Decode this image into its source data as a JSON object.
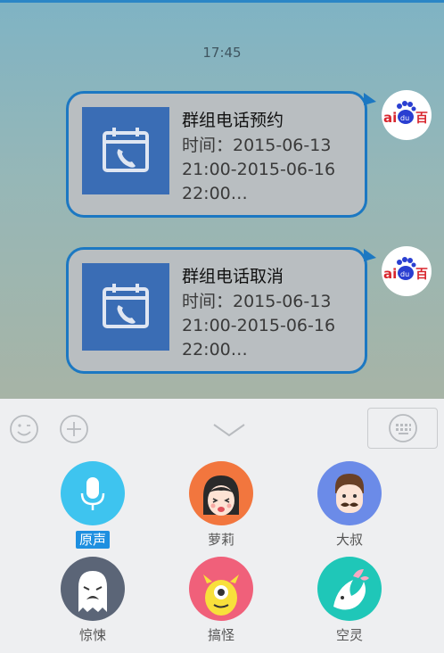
{
  "chat": {
    "time": "17:45",
    "messages": [
      {
        "title": "群组电话预约",
        "line1": "时间：2015-06-13",
        "line2": "21:00-2015-06-16",
        "line3": "22:00…",
        "avatar_text": "百度"
      },
      {
        "title": "群组电话取消",
        "line1": "时间：2015-06-13",
        "line2": "21:00-2015-06-16",
        "line3": "22:00…",
        "avatar_text": "百度"
      }
    ]
  },
  "panel": {
    "voices": [
      {
        "label": "原声",
        "selected": true,
        "color": "#3ec4ef"
      },
      {
        "label": "萝莉",
        "selected": false,
        "color": "#f2763e"
      },
      {
        "label": "大叔",
        "selected": false,
        "color": "#6b8be8"
      },
      {
        "label": "惊悚",
        "selected": false,
        "color": "#5b6577"
      },
      {
        "label": "搞怪",
        "selected": false,
        "color": "#f0607a"
      },
      {
        "label": "空灵",
        "selected": false,
        "color": "#1fc7b8"
      }
    ]
  },
  "colors": {
    "accent": "#1c78c2",
    "card_icon_bg": "#3a6db5",
    "selected_label": "#1e8fe0"
  }
}
